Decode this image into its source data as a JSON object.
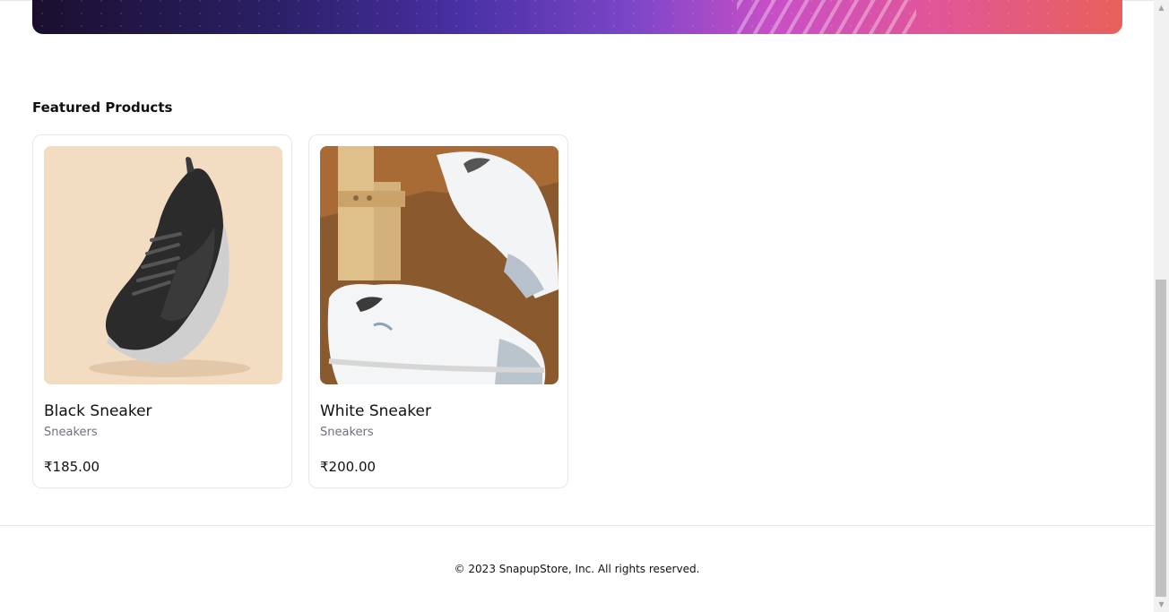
{
  "section": {
    "title": "Featured Products"
  },
  "products": [
    {
      "name": "Black Sneaker",
      "category": "Sneakers",
      "price": "₹185.00",
      "image_icon": "black-sneaker-image"
    },
    {
      "name": "White Sneaker",
      "category": "Sneakers",
      "price": "₹200.00",
      "image_icon": "white-sneaker-image"
    }
  ],
  "footer": {
    "text": "© 2023 SnapupStore, Inc. All rights reserved."
  },
  "colors": {
    "banner_start": "#1a0f2e",
    "banner_mid": "#4a31a6",
    "banner_pink": "#c84fc6",
    "banner_end": "#e8615a",
    "border": "#e5e7eb",
    "muted_text": "#6b7280"
  }
}
